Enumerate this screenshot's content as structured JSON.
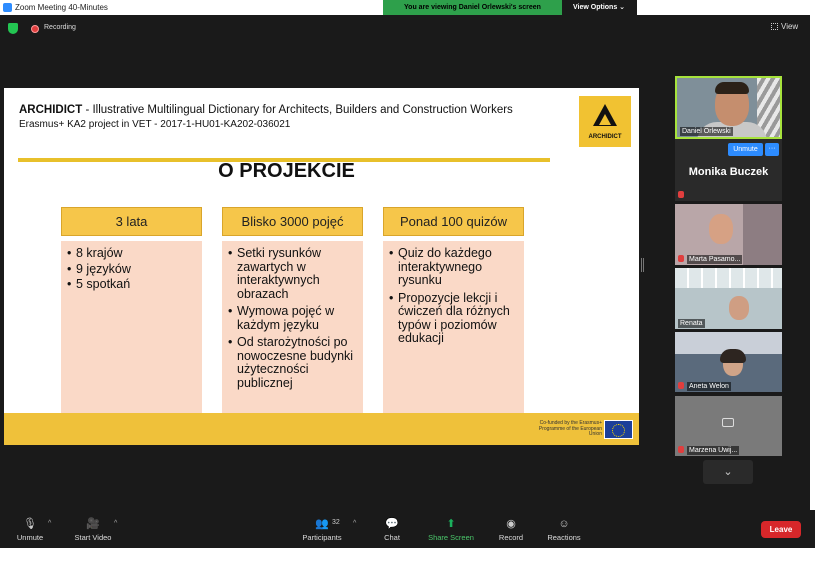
{
  "window": {
    "title": "Zoom Meeting 40-Minutes"
  },
  "banner": {
    "viewing": "You are viewing Daniel Orlewski's screen",
    "view_options": "View Options ⌄"
  },
  "meeting": {
    "recording_label": "Recording",
    "view_label": "View"
  },
  "slide": {
    "header_brand": "ARCHIDICT",
    "header_text": " - Illustrative Multilingual Dictionary for Architects, Builders and Construction Workers",
    "sub_text": "Erasmus+ KA2 project in VET - 2017-1-HU01-KA202-036021",
    "logo_text": "ARCHIDICT",
    "title": "O PROJEKCIE",
    "columns": [
      {
        "head": "3 lata",
        "items": [
          "8 krajów",
          "9 języków",
          "5 spotkań"
        ]
      },
      {
        "head": "Blisko 3000 pojęć",
        "items": [
          "Setki rysunków zawartych w interaktywnych obrazach",
          "Wymowa pojęć w każdym języku",
          "Od starożytności po nowoczesne budynki użyteczności publicznej"
        ]
      },
      {
        "head": "Ponad 100 quizów",
        "items": [
          "Quiz do każdego interaktywnego rysunku",
          "Propozycje lekcji i ćwiczeń dla różnych typów i poziomów edukacji"
        ]
      }
    ],
    "eu_text": "Co-funded by the Erasmus+ Programme of the European Union"
  },
  "gallery": {
    "daniel": "Daniel Orlewski",
    "monika": "Monika Buczek",
    "unmute": "Unmute",
    "more": "···",
    "marta": "Marta Pasamo...",
    "renata": "Renata",
    "aneta": "Aneta Welon",
    "marzena": "Marzena Uwij..."
  },
  "toolbar": {
    "unmute": "Unmute",
    "start_video": "Start Video",
    "participants": "Participants",
    "participants_count": "32",
    "chat": "Chat",
    "share_screen": "Share Screen",
    "record": "Record",
    "reactions": "Reactions",
    "leave": "Leave"
  },
  "colors": {
    "accent_green": "#2ea04b",
    "zoom_blue": "#2d8cff",
    "leave_red": "#d7272a",
    "slide_gold": "#efc13a"
  }
}
